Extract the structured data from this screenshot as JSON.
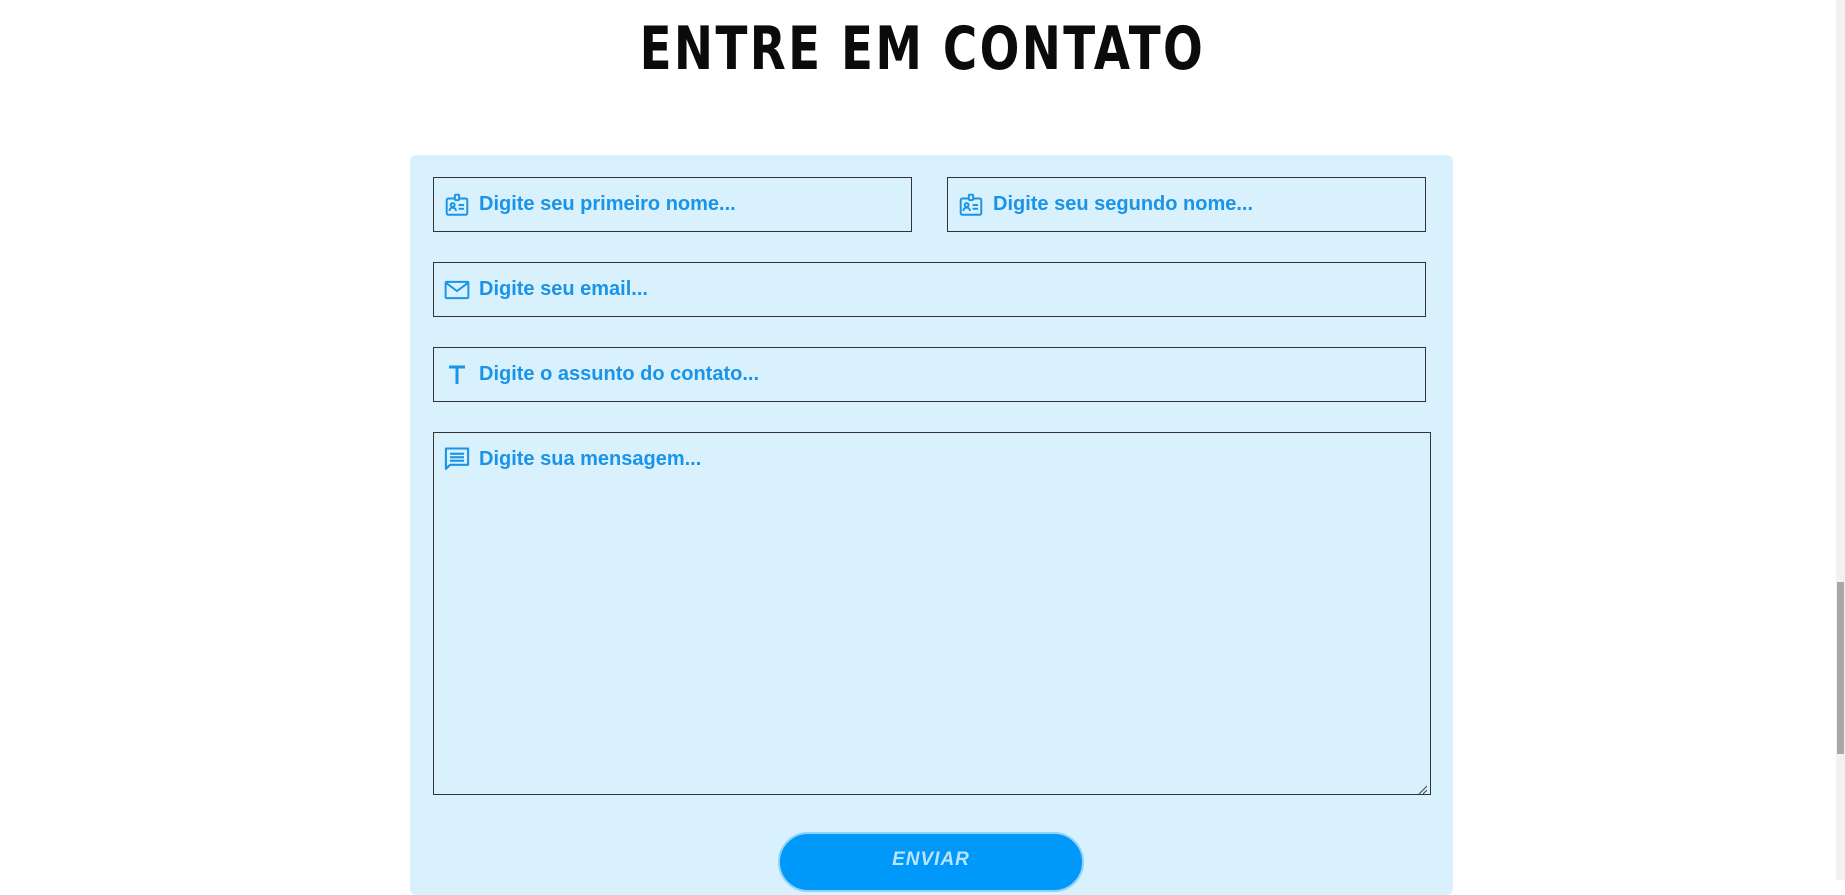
{
  "page": {
    "title": "ENTRE EM CONTATO"
  },
  "form": {
    "first_name": {
      "placeholder": "Digite seu primeiro nome...",
      "icon": "id-card-icon"
    },
    "last_name": {
      "placeholder": "Digite seu segundo nome...",
      "icon": "id-card-icon"
    },
    "email": {
      "placeholder": "Digite seu email...",
      "icon": "envelope-icon"
    },
    "subject": {
      "placeholder": "Digite o assunto do contato...",
      "icon": "text-icon"
    },
    "message": {
      "placeholder": "Digite sua mensagem...",
      "icon": "message-icon"
    },
    "submit_label": "ENVIAR"
  },
  "colors": {
    "accent": "#1a94e6",
    "card_background": "#d9f0fd",
    "button": "#0098f9"
  }
}
